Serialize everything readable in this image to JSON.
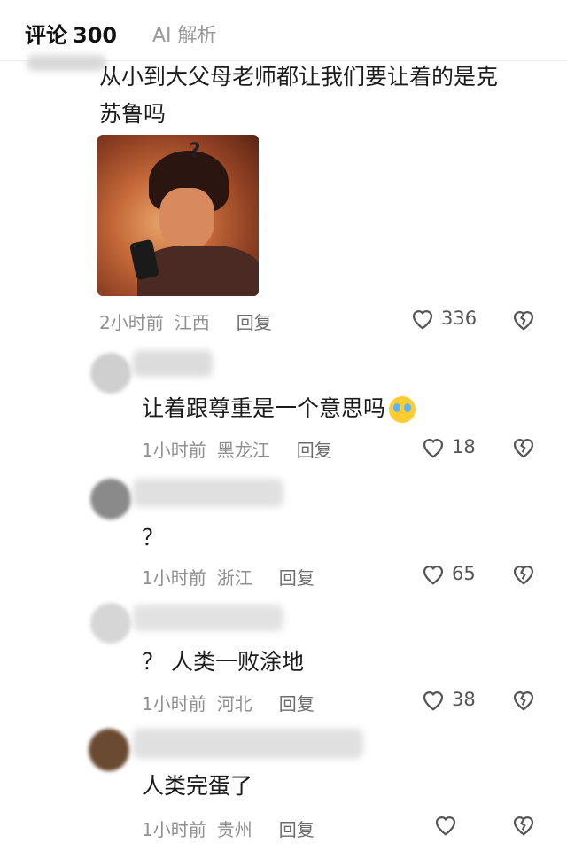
{
  "tabs": {
    "comments_label": "评论",
    "comments_count": "300",
    "ai_label": "AI 解析"
  },
  "comments": [
    {
      "text_line1": "从小到大父母老师都让我们要让着的是克",
      "text_line2": "苏鲁吗",
      "time": "2小时前",
      "location": "江西",
      "reply": "回复",
      "likes": "336",
      "image": "shocked-anime-character-with-phone"
    },
    {
      "text": "让着跟尊重是一个意思吗",
      "emoji": "crying-laughing-emoji",
      "time": "1小时前",
      "location": "黑龙江",
      "reply": "回复",
      "likes": "18"
    },
    {
      "text": "？",
      "time": "1小时前",
      "location": "浙江",
      "reply": "回复",
      "likes": "65"
    },
    {
      "text": "？ 人类一败涂地",
      "time": "1小时前",
      "location": "河北",
      "reply": "回复",
      "likes": "38"
    },
    {
      "text": "人类完蛋了",
      "time": "1小时前",
      "location": "贵州",
      "reply": "回复",
      "likes": ""
    }
  ],
  "colors": {
    "text": "#1c1c1c",
    "meta": "#8f8f8f",
    "icon": "#555555",
    "image_warm": "#c66a3a"
  },
  "icons": {
    "like": "heart-outline-icon",
    "dislike": "broken-heart-icon"
  }
}
